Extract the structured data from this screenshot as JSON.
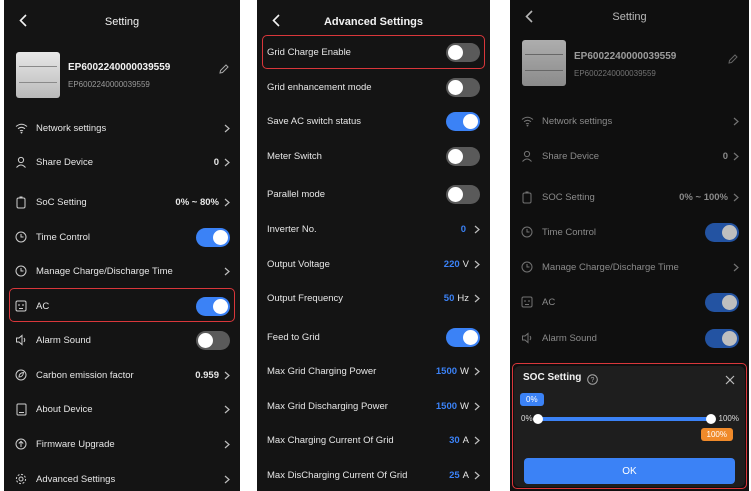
{
  "colors": {
    "accent": "#3b82f6",
    "highlight": "#d9373b",
    "background": "#141414"
  },
  "panel1": {
    "header_title": "Setting",
    "device": {
      "name": "EP6002240000039559",
      "serial": "EP6002240000039559"
    },
    "items": [
      {
        "label": "Network settings",
        "icon": "wifi-icon"
      },
      {
        "label": "Share Device",
        "icon": "user-icon",
        "value": "0"
      },
      {
        "label": "SoC Setting",
        "icon": "battery-icon",
        "value": "0% ~ 80%"
      },
      {
        "label": "Time Control",
        "icon": "clock-icon",
        "toggle": true
      },
      {
        "label": "Manage Charge/Discharge Time",
        "icon": "clock-icon"
      },
      {
        "label": "AC",
        "icon": "ac-outlet-icon",
        "toggle": true
      },
      {
        "label": "Alarm Sound",
        "icon": "speaker-icon",
        "toggle": false
      },
      {
        "label": "Carbon emission factor",
        "icon": "leaf-icon",
        "value": "0.959"
      },
      {
        "label": "About Device",
        "icon": "document-icon"
      },
      {
        "label": "Firmware Upgrade",
        "icon": "upgrade-icon"
      },
      {
        "label": "Advanced Settings",
        "icon": "gear-icon"
      }
    ]
  },
  "panel2": {
    "header_title": "Advanced Settings",
    "items": [
      {
        "label": "Grid Charge Enable",
        "toggle": false
      },
      {
        "label": "Grid enhancement mode",
        "toggle": false
      },
      {
        "label": "Save AC switch status",
        "toggle": true
      },
      {
        "label": "Meter Switch",
        "toggle": false
      },
      {
        "label": "Parallel mode",
        "toggle": false
      },
      {
        "label": "Inverter No.",
        "value": "0",
        "unit": ""
      },
      {
        "label": "Output Voltage",
        "value": "220",
        "unit": "V"
      },
      {
        "label": "Output Frequency",
        "value": "50",
        "unit": "Hz"
      },
      {
        "label": "Feed to Grid",
        "toggle": true
      },
      {
        "label": "Max Grid Charging Power",
        "value": "1500",
        "unit": "W"
      },
      {
        "label": "Max Grid Discharging Power",
        "value": "1500",
        "unit": "W"
      },
      {
        "label": "Max Charging Current Of Grid",
        "value": "30",
        "unit": "A"
      },
      {
        "label": "Max DisCharging Current Of Grid",
        "value": "25",
        "unit": "A"
      }
    ]
  },
  "panel3": {
    "header_title": "Setting",
    "device": {
      "name": "EP6002240000039559",
      "serial": "EP6002240000039559"
    },
    "items": [
      {
        "label": "Network settings",
        "icon": "wifi-icon"
      },
      {
        "label": "Share Device",
        "icon": "user-icon",
        "value": "0"
      },
      {
        "label": "SOC Setting",
        "icon": "battery-icon",
        "value": "0% ~ 100%"
      },
      {
        "label": "Time Control",
        "icon": "clock-icon",
        "toggle": true
      },
      {
        "label": "Manage Charge/Discharge Time",
        "icon": "clock-icon"
      },
      {
        "label": "AC",
        "icon": "ac-outlet-icon",
        "toggle": true
      },
      {
        "label": "Alarm Sound",
        "icon": "speaker-icon",
        "toggle": true
      }
    ],
    "soc_dialog": {
      "title": "SOC Setting",
      "min_bubble": "0%",
      "max_bubble": "100%",
      "min_label": "0%",
      "max_label": "100%",
      "range_min_percent": 0,
      "range_max_percent": 100,
      "ok_label": "OK"
    }
  }
}
